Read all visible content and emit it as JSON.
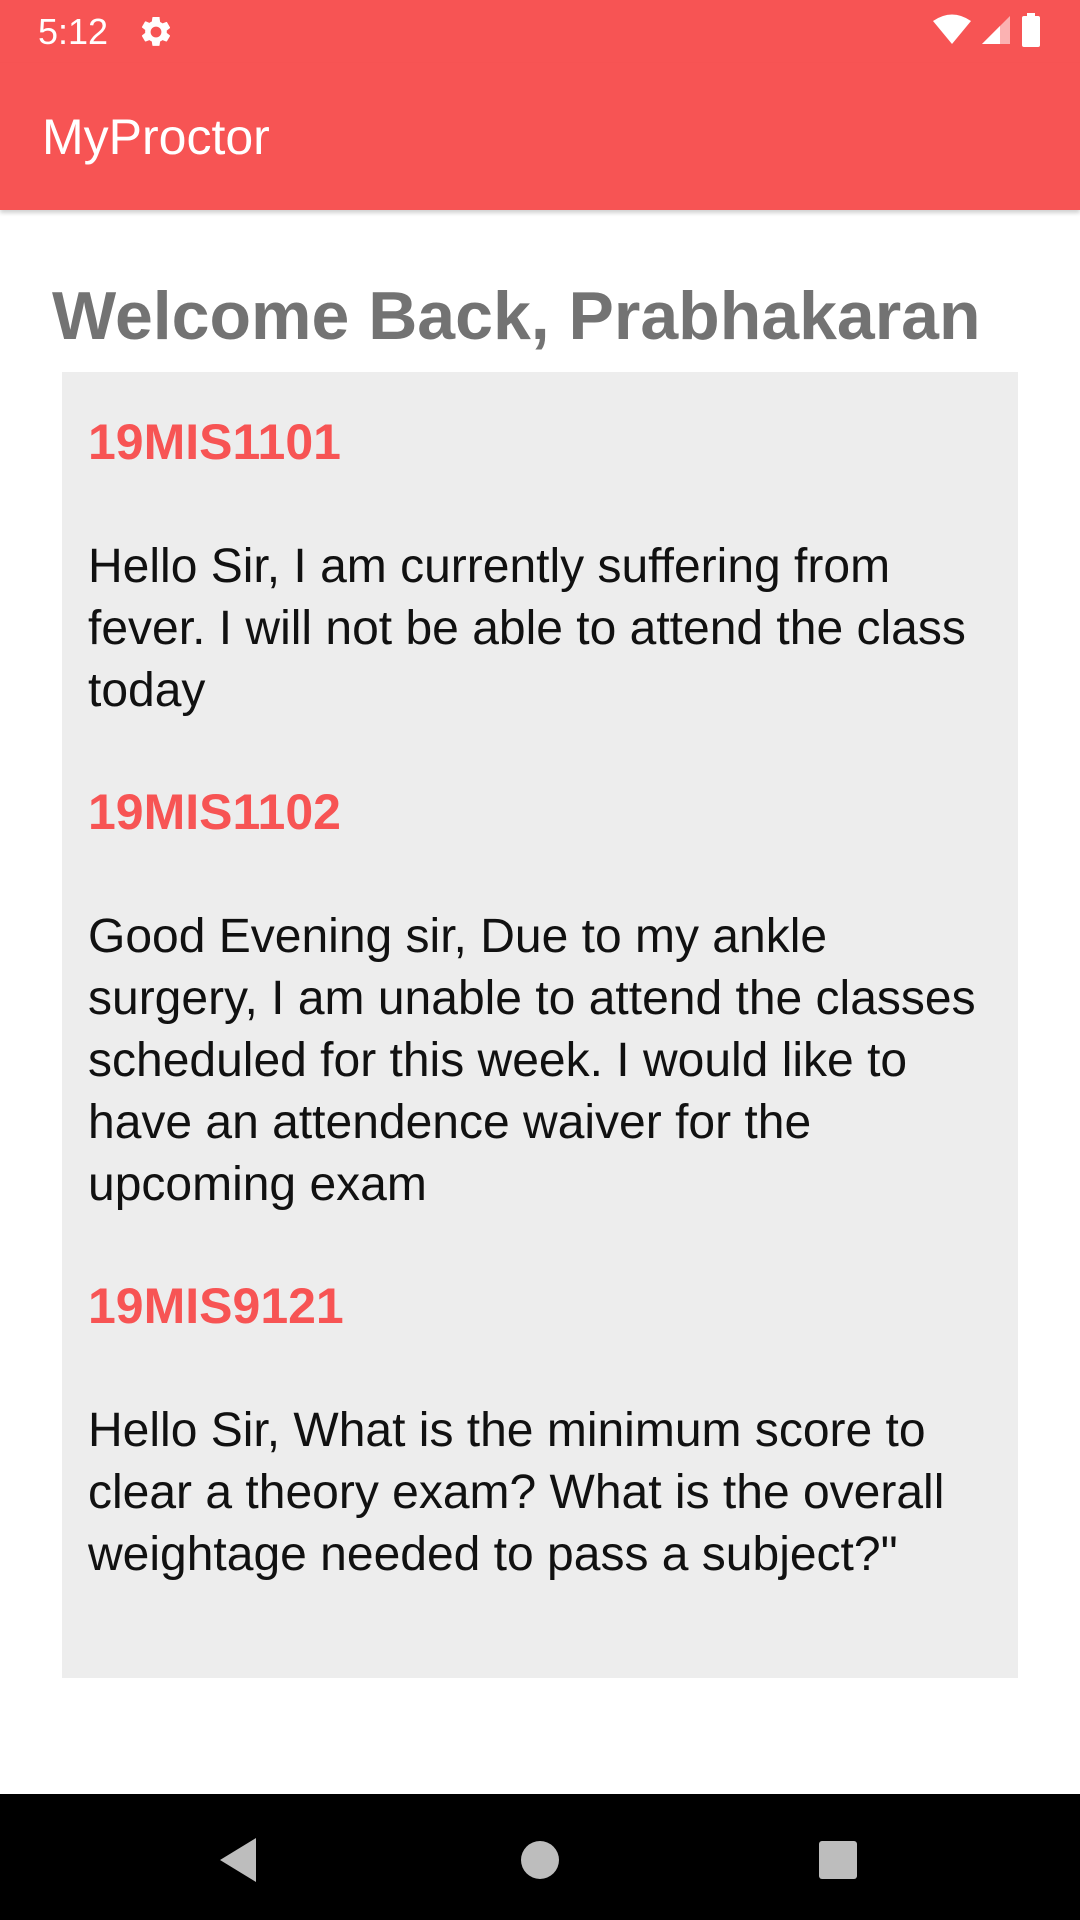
{
  "status_bar": {
    "time": "5:12",
    "icons": [
      "gear-icon",
      "wifi-icon",
      "signal-icon",
      "battery-icon"
    ]
  },
  "app_bar": {
    "title": "MyProctor"
  },
  "welcome_text": "Welcome Back, Prabhakaran",
  "messages": [
    {
      "id": "19MIS1101",
      "text": "Hello Sir, I am currently suffering from fever. I will not be able to attend the class today"
    },
    {
      "id": "19MIS1102",
      "text": "Good Evening sir, Due to my ankle surgery, I am unable to attend the classes scheduled for this week. I would like to have an attendence waiver for the upcoming exam"
    },
    {
      "id": "19MIS9121",
      "text": "Hello Sir, What is the minimum score to clear a theory exam? What is the overall weightage needed to pass a subject?\""
    }
  ],
  "nav_bar": {
    "buttons": [
      "back-icon",
      "home-icon",
      "recents-icon"
    ]
  },
  "colors": {
    "accent": "#f75454",
    "welcome_text": "#737373",
    "card_background": "#ededed"
  }
}
